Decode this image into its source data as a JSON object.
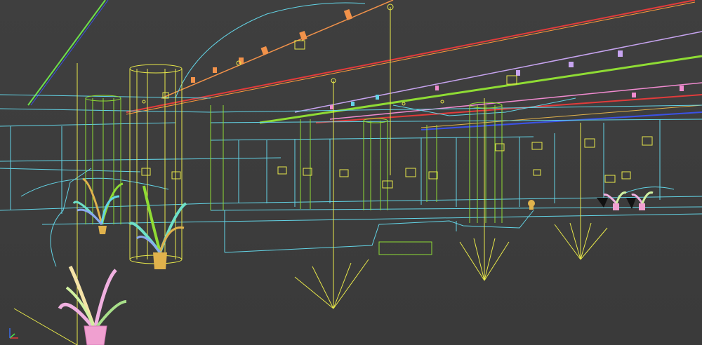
{
  "viewport": {
    "mode": "wireframe",
    "background": "#3d3d3d"
  },
  "colors": {
    "cyan": "#63d4e6",
    "yellow": "#e8e84a",
    "green": "#8fdc34",
    "lime": "#b6f24a",
    "orange": "#f2924a",
    "pink": "#f08bd0",
    "lavender": "#c7a4f0",
    "red": "#e23b3b",
    "blue": "#3b52e6",
    "gold": "#e0b24c",
    "white": "#ffffff"
  },
  "gizmo": {
    "axes": [
      "x-axis",
      "y-axis",
      "z-axis"
    ],
    "colors": [
      "#e23b3b",
      "#4be24b",
      "#3b6be6"
    ]
  }
}
